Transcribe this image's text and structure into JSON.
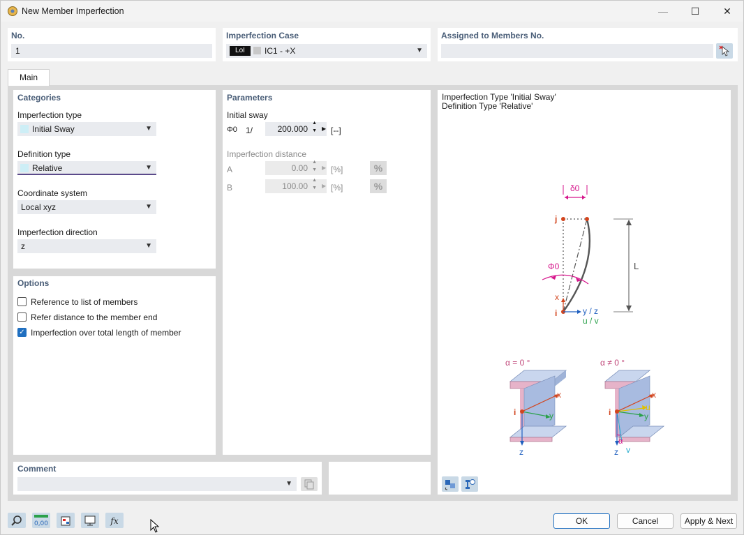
{
  "window": {
    "title": "New Member Imperfection",
    "minimize_glyph": "—",
    "maximize_glyph": "☐",
    "close_glyph": "✕"
  },
  "top": {
    "no_label": "No.",
    "no_value": "1",
    "case_label": "Imperfection Case",
    "case_badge": "LoI",
    "case_value": "IC1 - +X",
    "assigned_label": "Assigned to Members No.",
    "assigned_value": ""
  },
  "tabs": [
    {
      "label": "Main"
    }
  ],
  "categories": {
    "header": "Categories",
    "imperfection_type_label": "Imperfection type",
    "imperfection_type_value": "Initial Sway",
    "definition_type_label": "Definition type",
    "definition_type_value": "Relative",
    "coordinate_system_label": "Coordinate system",
    "coordinate_system_value": "Local xyz",
    "imperfection_direction_label": "Imperfection direction",
    "imperfection_direction_value": "z"
  },
  "options": {
    "header": "Options",
    "items": [
      {
        "label": "Reference to list of members",
        "checked": false
      },
      {
        "label": "Refer distance to the member end",
        "checked": false
      },
      {
        "label": "Imperfection over total length of member",
        "checked": true
      }
    ]
  },
  "parameters": {
    "header": "Parameters",
    "initial_sway_label": "Initial sway",
    "phi_symbol": "Φ0",
    "phi_prefix": "1/",
    "phi_value": "200.000",
    "phi_unit": "[--]",
    "imperfection_distance_label": "Imperfection distance",
    "a_label": "A",
    "a_value": "0.00",
    "a_unit": "[%]",
    "b_label": "B",
    "b_value": "100.00",
    "b_unit": "[%]",
    "pct_glyph": "%"
  },
  "preview": {
    "line1": "Imperfection Type 'Initial Sway'",
    "line2": "Definition Type 'Relative'",
    "delta": "δ0",
    "phi": "Φ0",
    "L": "L",
    "j": "j",
    "i": "i",
    "x": "x",
    "yz": "y / z",
    "uv": "u / v",
    "alpha0": "α = 0 °",
    "alphaNot0": "α ≠ 0 °",
    "s1_x": "x",
    "s1_y": "y",
    "s1_i": "i",
    "s1_z": "z",
    "s2_x": "x",
    "s2_u": "u",
    "s2_y": "y",
    "s2_i": "i",
    "s2_z": "z",
    "s2_v": "v",
    "s2_alpha": "α"
  },
  "comment": {
    "label": "Comment",
    "value": ""
  },
  "footer": {
    "ok": "OK",
    "cancel": "Cancel",
    "apply_next": "Apply & Next"
  },
  "colors": {
    "accent": "#1f6fc0",
    "header_text": "#4a5e78",
    "magenta": "#d6168c",
    "node_orange": "#d2451e",
    "axis_blue": "#1f5fbf",
    "axis_green": "#2aa14a",
    "axis_yellow": "#e0c000"
  }
}
